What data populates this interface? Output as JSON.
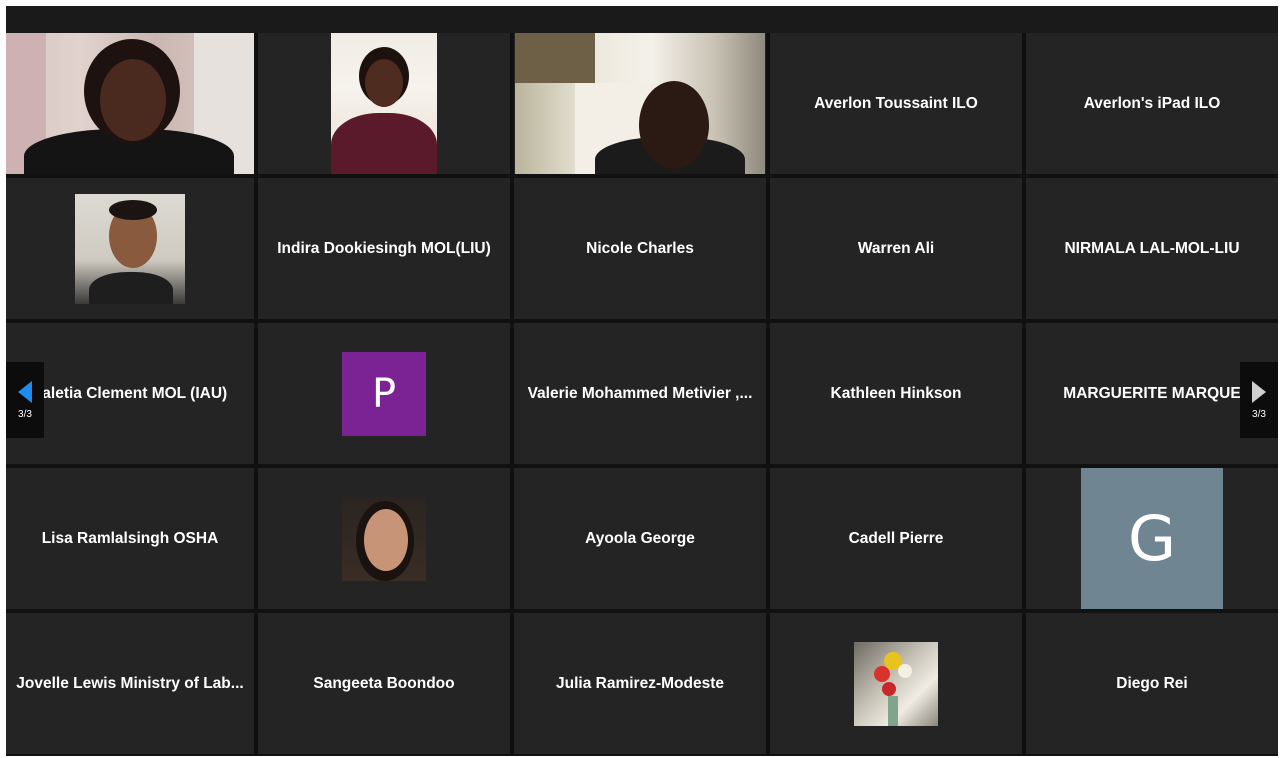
{
  "participants": [
    {
      "name": "",
      "kind": "video"
    },
    {
      "name": "",
      "kind": "video"
    },
    {
      "name": "",
      "kind": "video"
    },
    {
      "name": "Averlon Toussaint ILO",
      "kind": "name"
    },
    {
      "name": "Averlon's iPad ILO",
      "kind": "name"
    },
    {
      "name": "",
      "kind": "photo"
    },
    {
      "name": "Indira Dookiesingh MOL(LIU)",
      "kind": "name"
    },
    {
      "name": "Nicole Charles",
      "kind": "name"
    },
    {
      "name": "Warren Ali",
      "kind": "name"
    },
    {
      "name": "NIRMALA LAL-MOL-LIU",
      "kind": "name"
    },
    {
      "name": "Valetia Clement MOL (IAU)",
      "kind": "name"
    },
    {
      "name": "",
      "kind": "avatar",
      "letter": "P",
      "color": "#7b2394"
    },
    {
      "name": "Valerie Mohammed Metivier ,...",
      "kind": "name"
    },
    {
      "name": "Kathleen Hinkson",
      "kind": "name"
    },
    {
      "name": "MARGUERITE MARQUE",
      "kind": "name"
    },
    {
      "name": "Lisa Ramlalsingh OSHA",
      "kind": "name"
    },
    {
      "name": "",
      "kind": "photo"
    },
    {
      "name": "Ayoola George",
      "kind": "name"
    },
    {
      "name": "Cadell Pierre",
      "kind": "name"
    },
    {
      "name": "",
      "kind": "avatar",
      "letter": "G",
      "color": "#6f8592"
    },
    {
      "name": "Jovelle Lewis Ministry of Lab...",
      "kind": "name"
    },
    {
      "name": "Sangeeta Boondoo",
      "kind": "name"
    },
    {
      "name": "Julia Ramirez-Modeste",
      "kind": "name"
    },
    {
      "name": "",
      "kind": "photo"
    },
    {
      "name": "Diego Rei",
      "kind": "name"
    }
  ],
  "navigation": {
    "prev_page_label": "3/3",
    "next_page_label": "3/3",
    "prev_arrow_color": "#1d8cf0",
    "next_arrow_color": "#cfcfcf",
    "prev_icon": "arrow-left-icon",
    "next_icon": "arrow-right-icon"
  },
  "colors": {
    "background": "#1a1a1a",
    "tile": "#242424"
  }
}
